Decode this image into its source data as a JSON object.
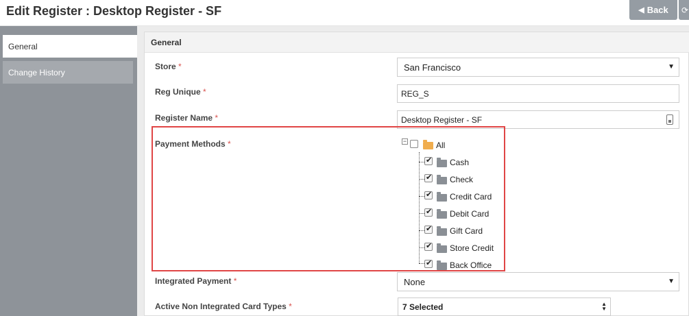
{
  "header": {
    "title": "Edit Register : Desktop Register - SF",
    "back_label": "Back",
    "back_icon": "arrow-left-icon",
    "extra_icon": "refresh-icon"
  },
  "sidebar": {
    "items": [
      {
        "label": "General",
        "active": true
      },
      {
        "label": "Change History",
        "active": false
      }
    ]
  },
  "panel": {
    "title": "General"
  },
  "form": {
    "store": {
      "label": "Store",
      "required": "*",
      "value": "San Francisco"
    },
    "reg_unique": {
      "label": "Reg Unique",
      "required": "*",
      "value": "REG_S"
    },
    "register_name": {
      "label": "Register Name",
      "required": "*",
      "value": "Desktop Register - SF"
    },
    "payment_methods": {
      "label": "Payment Methods",
      "required": "*",
      "root": {
        "label": "All",
        "checked": false,
        "toggle": "−"
      },
      "items": [
        {
          "label": "Cash",
          "checked": true
        },
        {
          "label": "Check",
          "checked": true
        },
        {
          "label": "Credit Card",
          "checked": true
        },
        {
          "label": "Debit Card",
          "checked": true
        },
        {
          "label": "Gift Card",
          "checked": true
        },
        {
          "label": "Store Credit",
          "checked": true
        },
        {
          "label": "Back Office",
          "checked": true
        }
      ]
    },
    "integrated_payment": {
      "label": "Integrated Payment",
      "required": "*",
      "value": "None"
    },
    "card_types": {
      "label": "Active Non Integrated Card Types",
      "required": "*",
      "value": "7 Selected"
    }
  },
  "colors": {
    "highlight": "#e04545",
    "sidebar": "#8e9399",
    "required": "#d9534f",
    "open_folder": "#f0ad4e"
  }
}
